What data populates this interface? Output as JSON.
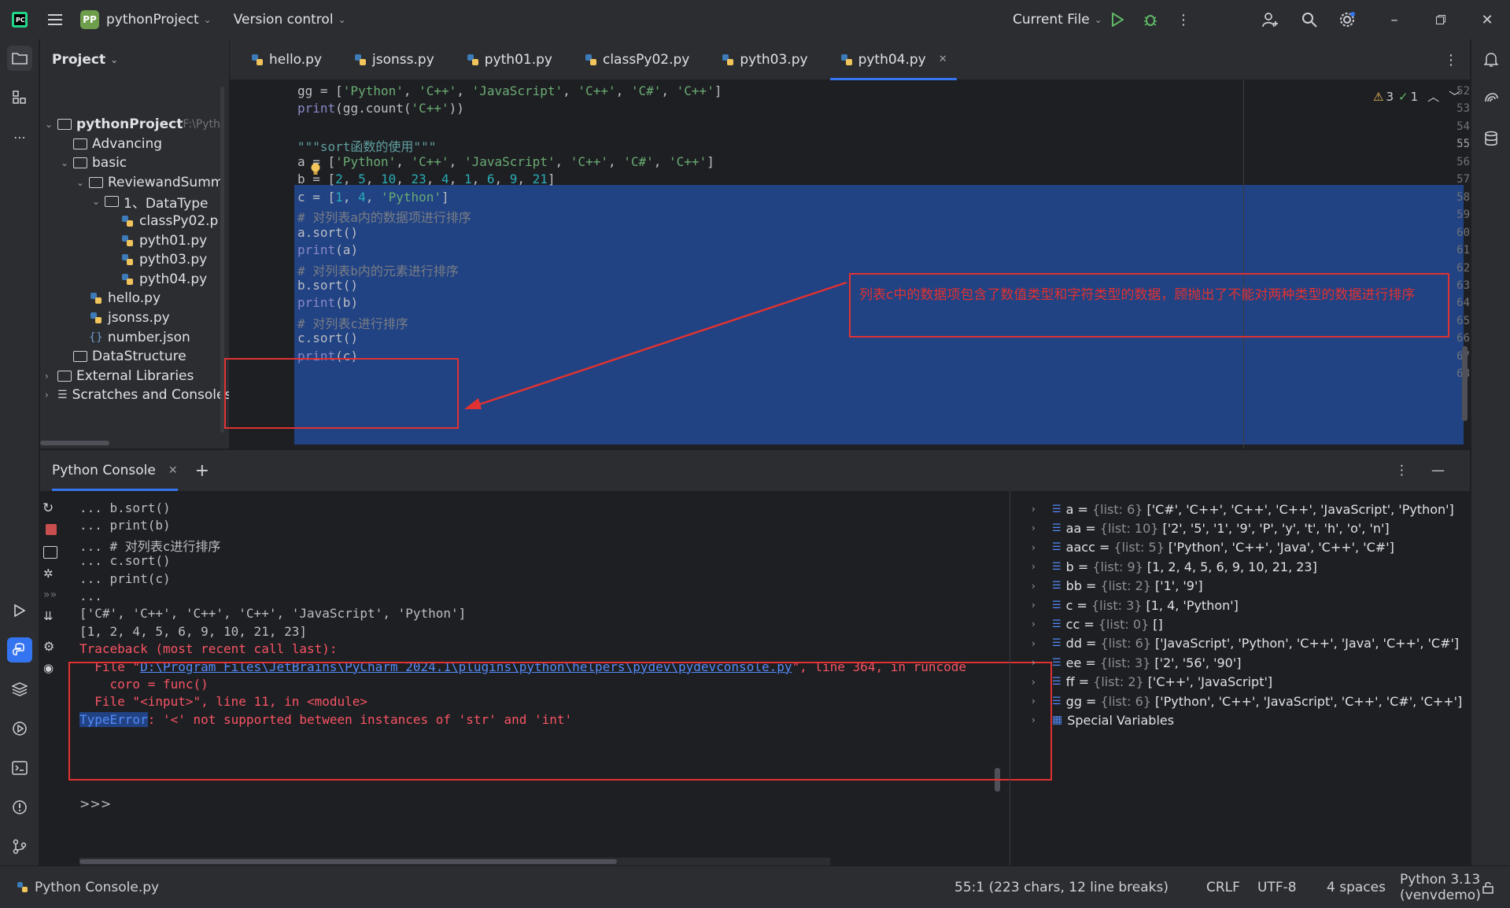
{
  "titlebar": {
    "project_badge": "PP",
    "project_name": "pythonProject",
    "vcs": "Version control",
    "run_config": "Current File"
  },
  "project_panel": {
    "title": "Project",
    "tree": [
      {
        "label": "pythonProject",
        "suffix": "F:\\Pyth",
        "kind": "folder",
        "depth": 0,
        "expanded": true
      },
      {
        "label": "Advancing",
        "kind": "folder",
        "depth": 1
      },
      {
        "label": "basic",
        "kind": "folder",
        "depth": 1,
        "expanded": true
      },
      {
        "label": "ReviewandSumm",
        "kind": "folder",
        "depth": 2,
        "expanded": true
      },
      {
        "label": "1、DataType",
        "kind": "folder",
        "depth": 3,
        "expanded": true
      },
      {
        "label": "classPy02.p",
        "kind": "py",
        "depth": 4
      },
      {
        "label": "pyth01.py",
        "kind": "py",
        "depth": 4
      },
      {
        "label": "pyth03.py",
        "kind": "py",
        "depth": 4
      },
      {
        "label": "pyth04.py",
        "kind": "py",
        "depth": 4
      },
      {
        "label": "hello.py",
        "kind": "py",
        "depth": 2
      },
      {
        "label": "jsonss.py",
        "kind": "py",
        "depth": 2
      },
      {
        "label": "number.json",
        "kind": "json",
        "depth": 2
      },
      {
        "label": "DataStructure",
        "kind": "folder",
        "depth": 1
      },
      {
        "label": "External Libraries",
        "kind": "lib",
        "depth": 0
      },
      {
        "label": "Scratches and Consoles",
        "kind": "scratch",
        "depth": 0
      }
    ]
  },
  "tabs": [
    "hello.py",
    "jsonss.py",
    "pyth01.py",
    "classPy02.py",
    "pyth03.py",
    "pyth04.py"
  ],
  "active_tab": "pyth04.py",
  "inspections": {
    "warnings": "3",
    "ok": "1"
  },
  "code": [
    {
      "n": "52",
      "text": "gg = ['Python', 'C++', 'JavaScript', 'C++', 'C#', 'C++']"
    },
    {
      "n": "53",
      "text": "print(gg.count('C++'))"
    },
    {
      "n": "54",
      "text": ""
    },
    {
      "n": "55",
      "text": "\"\"\"sort函数的使用\"\"\""
    },
    {
      "n": "56",
      "text": "a = ['Python', 'C++', 'JavaScript', 'C++', 'C#', 'C++']"
    },
    {
      "n": "57",
      "text": "b = [2, 5, 10, 23, 4, 1, 6, 9, 21]"
    },
    {
      "n": "58",
      "text": "c = [1, 4, 'Python']"
    },
    {
      "n": "59",
      "text": "# 对列表a内的数据项进行排序"
    },
    {
      "n": "60",
      "text": "a.sort()"
    },
    {
      "n": "61",
      "text": "print(a)"
    },
    {
      "n": "62",
      "text": "# 对列表b内的元素进行排序"
    },
    {
      "n": "63",
      "text": "b.sort()"
    },
    {
      "n": "64",
      "text": "print(b)"
    },
    {
      "n": "65",
      "text": "# 对列表c进行排序"
    },
    {
      "n": "66",
      "text": "c.sort()"
    },
    {
      "n": "67",
      "text": "print(c)"
    },
    {
      "n": "68",
      "text": ""
    }
  ],
  "annotation": "列表c中的数据项包含了数值类型和字符类型的数据，顾抛出了不能对两种类型的数据进行排序",
  "console": {
    "title": "Python Console",
    "lines": [
      {
        "text": "... b.sort()",
        "err": false
      },
      {
        "text": "... print(b)",
        "err": false
      },
      {
        "text": "... # 对列表c进行排序",
        "err": false
      },
      {
        "text": "... c.sort()",
        "err": false
      },
      {
        "text": "... print(c)",
        "err": false
      },
      {
        "text": "...",
        "err": false
      },
      {
        "text": "['C#', 'C++', 'C++', 'C++', 'JavaScript', 'Python']",
        "err": false
      },
      {
        "text": "[1, 2, 4, 5, 6, 9, 10, 21, 23]",
        "err": false
      },
      {
        "text": "Traceback (most recent call last):",
        "err": true
      },
      {
        "text": "  File \"D:\\Program Files\\JetBrains\\PyCharm 2024.1\\plugins\\python\\helpers\\pydev\\pydevconsole.py\", line 364, in runcode",
        "err": true
      },
      {
        "text": "    coro = func()",
        "err": true
      },
      {
        "text": "  File \"<input>\", line 11, in <module>",
        "err": true
      },
      {
        "text": "TypeError: '<' not supported between instances of 'str' and 'int'",
        "err": true
      }
    ],
    "prompt": ">>>"
  },
  "variables": [
    {
      "name": "a",
      "type": "{list: 6}",
      "value": "['C#', 'C++', 'C++', 'C++', 'JavaScript', 'Python']"
    },
    {
      "name": "aa",
      "type": "{list: 10}",
      "value": "['2', '5', '1', '9', 'P', 'y', 't', 'h', 'o', 'n']"
    },
    {
      "name": "aacc",
      "type": "{list: 5}",
      "value": "['Python', 'C++', 'Java', 'C++', 'C#']"
    },
    {
      "name": "b",
      "type": "{list: 9}",
      "value": "[1, 2, 4, 5, 6, 9, 10, 21, 23]"
    },
    {
      "name": "bb",
      "type": "{list: 2}",
      "value": "['1', '9']"
    },
    {
      "name": "c",
      "type": "{list: 3}",
      "value": "[1, 4, 'Python']"
    },
    {
      "name": "cc",
      "type": "{list: 0}",
      "value": "[]"
    },
    {
      "name": "dd",
      "type": "{list: 6}",
      "value": "['JavaScript', 'Python', 'C++', 'Java', 'C++', 'C#']"
    },
    {
      "name": "ee",
      "type": "{list: 3}",
      "value": "['2', '56', '90']"
    },
    {
      "name": "ff",
      "type": "{list: 2}",
      "value": "['C++', 'JavaScript']"
    },
    {
      "name": "gg",
      "type": "{list: 6}",
      "value": "['Python', 'C++', 'JavaScript', 'C++', 'C#', 'C++']"
    }
  ],
  "special_variables": "Special Variables",
  "statusbar": {
    "left": "Python Console.py",
    "position": "55:1 (223 chars, 12 line breaks)",
    "line_sep": "CRLF",
    "encoding": "UTF-8",
    "indent": "4 spaces",
    "interpreter": "Python 3.13 (venvdemo)"
  }
}
